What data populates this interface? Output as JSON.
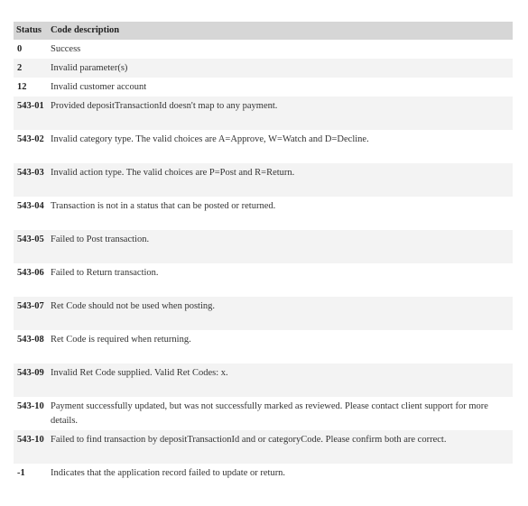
{
  "table": {
    "headers": {
      "status": "Status",
      "description": "Code description"
    },
    "rows": [
      {
        "status": "0",
        "description": "Success"
      },
      {
        "status": "2",
        "description": "Invalid parameter(s)"
      },
      {
        "status": "12",
        "description": "Invalid customer account"
      },
      {
        "status": "543-01",
        "description": "Provided depositTransactionId doesn't map to any payment."
      },
      {
        "status": "543-02",
        "description": "Invalid category type. The valid choices are A=Approve, W=Watch and D=Decline."
      },
      {
        "status": "543-03",
        "description": "Invalid action type. The valid choices are P=Post and R=Return."
      },
      {
        "status": "543-04",
        "description": "Transaction is not in a status that can be posted or returned."
      },
      {
        "status": "543-05",
        "description": "Failed to Post transaction."
      },
      {
        "status": "543-06",
        "description": "Failed to Return transaction."
      },
      {
        "status": "543-07",
        "description": "Ret Code should not be used when posting."
      },
      {
        "status": "543-08",
        "description": "Ret Code is required when returning."
      },
      {
        "status": "543-09",
        "description": "Invalid Ret Code supplied. Valid Ret Codes: x."
      },
      {
        "status": "543-10",
        "description": "Payment successfully updated, but was not successfully marked as reviewed. Please contact client support for more details."
      },
      {
        "status": "543-10",
        "description": "Failed to find transaction by depositTransactionId and or categoryCode. Please confirm both are correct."
      },
      {
        "status": "-1",
        "description": "Indicates that the application record failed to update or return."
      }
    ]
  }
}
